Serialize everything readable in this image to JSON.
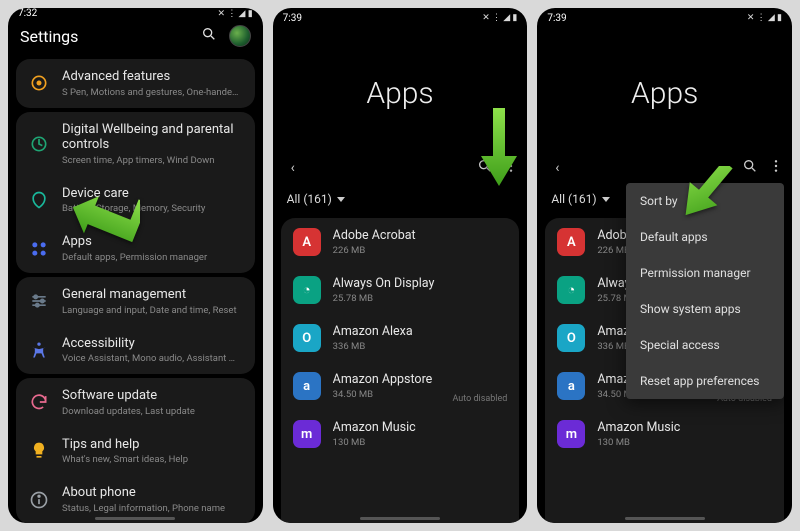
{
  "status": {
    "time1": "7:32",
    "time2": "7:39",
    "time3": "7:39",
    "icons_left": "◷ ▦ ✉",
    "icons_right": "✕ ⋮ ◢ ▮"
  },
  "screen1": {
    "title": "Settings",
    "groups": [
      [
        {
          "icon": "advanced",
          "iconColor": "#f0a020",
          "title": "Advanced features",
          "sub": "S Pen, Motions and gestures, One-handed mode"
        }
      ],
      [
        {
          "icon": "wellbeing",
          "iconColor": "#1fa574",
          "title": "Digital Wellbeing and parental controls",
          "sub": "Screen time, App timers, Wind Down"
        },
        {
          "icon": "devicecare",
          "iconColor": "#19b89b",
          "title": "Device care",
          "sub": "Battery, Storage, Memory, Security"
        },
        {
          "icon": "apps",
          "iconColor": "#4a6cf0",
          "title": "Apps",
          "sub": "Default apps, Permission manager"
        }
      ],
      [
        {
          "icon": "general",
          "iconColor": "#6a7a8a",
          "title": "General management",
          "sub": "Language and input, Date and time, Reset"
        },
        {
          "icon": "accessibility",
          "iconColor": "#5b77e6",
          "title": "Accessibility",
          "sub": "Voice Assistant, Mono audio, Assistant menu"
        }
      ],
      [
        {
          "icon": "update",
          "iconColor": "#e86a8f",
          "title": "Software update",
          "sub": "Download updates, Last update"
        },
        {
          "icon": "tips",
          "iconColor": "#f0b020",
          "title": "Tips and help",
          "sub": "What's new, Smart ideas, Help"
        },
        {
          "icon": "about",
          "iconColor": "#9aa0a6",
          "title": "About phone",
          "sub": "Status, Legal information, Phone name"
        }
      ]
    ]
  },
  "apps_screen": {
    "hero": "Apps",
    "filter": "All (161)",
    "list": [
      {
        "name": "Adobe Acrobat",
        "size": "226 MB",
        "bg": "#d63333",
        "initial": "A"
      },
      {
        "name": "Always On Display",
        "size": "25.78 MB",
        "bg": "#0aa283",
        "initial": "◔"
      },
      {
        "name": "Amazon Alexa",
        "size": "336 MB",
        "bg": "#1aa6c6",
        "initial": "O"
      },
      {
        "name": "Amazon Appstore",
        "size": "34.50 MB",
        "bg": "#2b74c4",
        "initial": "a",
        "auto": "Auto disabled"
      },
      {
        "name": "Amazon Music",
        "size": "130 MB",
        "bg": "#6b2bd6",
        "initial": "m"
      }
    ]
  },
  "popup": {
    "items": [
      "Sort by",
      "Default apps",
      "Permission manager",
      "Show system apps",
      "Special access",
      "Reset app preferences"
    ]
  }
}
